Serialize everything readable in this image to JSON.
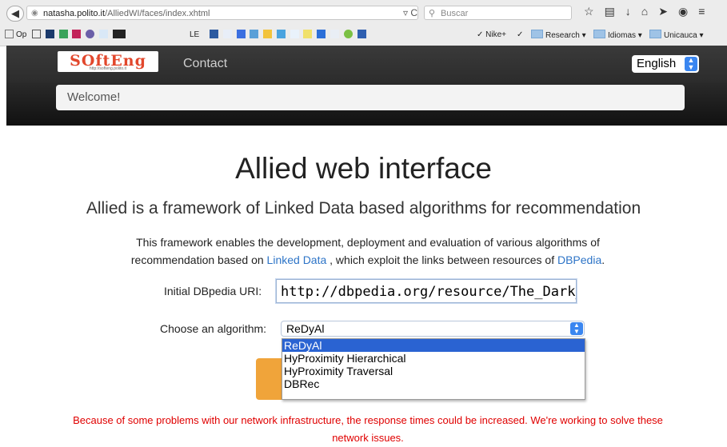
{
  "browser": {
    "url_host": "natasha.polito.it",
    "url_path": "/AlliedWI/faces/index.xhtml",
    "search_placeholder": "Buscar",
    "toolbar_icons": [
      "star-icon",
      "reading-list-icon",
      "download-icon",
      "home-icon",
      "send-icon",
      "chat-icon",
      "menu-icon"
    ],
    "bookmarks": [
      {
        "label": "Op"
      },
      {
        "label": "LE"
      },
      {
        "label": "Nike+"
      },
      {
        "label": "Research ▾"
      },
      {
        "label": "Idiomas ▾"
      },
      {
        "label": "Unicauca ▾"
      }
    ]
  },
  "header": {
    "logo_text": "SOftEng",
    "logo_url_text": "http://softeng.polito.it",
    "nav_contact": "Contact",
    "language": "English",
    "welcome": "Welcome!"
  },
  "main": {
    "title": "Allied web interface",
    "subtitle": "Allied is a framework of Linked Data based algorithms for recommendation",
    "desc_part1": "This framework enables the development, deployment and evaluation of various algorithms of recommendation based on ",
    "desc_link1": "Linked Data",
    "desc_part2": " , which exploit the links between resources of ",
    "desc_link2": "DBPedia",
    "desc_part3": ".",
    "uri_label": "Initial DBpedia URI:",
    "uri_value": "http://dbpedia.org/resource/The_Dark_Knig",
    "algo_label": "Choose an algorithm:",
    "algo_selected": "ReDyAl",
    "algo_options": [
      "ReDyAl",
      "HyProximity Hierarchical",
      "HyProximity Traversal",
      "DBRec"
    ],
    "warning": "Because of some problems with our network infrastructure, the response times could be increased. We're working to solve these network issues."
  },
  "colors": {
    "link": "#2d74c7",
    "warning": "#e00000",
    "selection": "#2a63d2",
    "submit": "#f0a43a",
    "logo": "#e2472c"
  }
}
